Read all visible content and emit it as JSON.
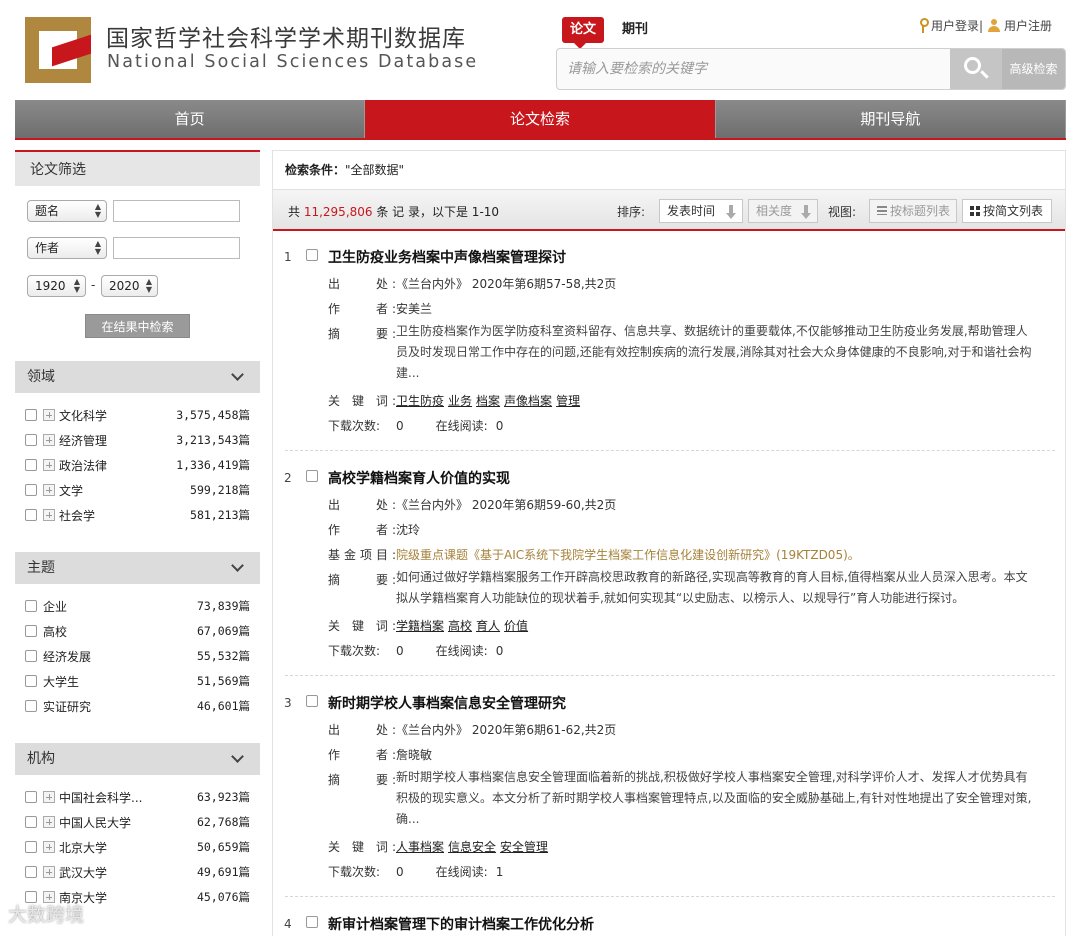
{
  "header": {
    "title_cn": "国家哲学社会科学学术期刊数据库",
    "title_en": "National Social Sciences Database",
    "search_types": [
      "论文",
      "期刊"
    ],
    "search_placeholder": "请输入要检索的关键字",
    "advanced_search": "高级检索",
    "login": "用户登录|",
    "register": "用户注册"
  },
  "nav": {
    "items": [
      "首页",
      "论文检索",
      "期刊导航"
    ],
    "active_index": 1
  },
  "sidebar": {
    "filter_title": "论文筛选",
    "field1": "题名",
    "field2": "作者",
    "year_from": "1920",
    "year_to": "2020",
    "year_dash": "-",
    "search_in_results": "在结果中检索",
    "facets": [
      {
        "title": "领域",
        "items": [
          {
            "label": "文化科学",
            "count": "3,575,458篇"
          },
          {
            "label": "经济管理",
            "count": "3,213,543篇"
          },
          {
            "label": "政治法律",
            "count": "1,336,419篇"
          },
          {
            "label": "文学",
            "count": "599,218篇"
          },
          {
            "label": "社会学",
            "count": "581,213篇"
          }
        ]
      },
      {
        "title": "主题",
        "items": [
          {
            "label": "企业",
            "count": "73,839篇"
          },
          {
            "label": "高校",
            "count": "67,069篇"
          },
          {
            "label": "经济发展",
            "count": "55,532篇"
          },
          {
            "label": "大学生",
            "count": "51,569篇"
          },
          {
            "label": "实证研究",
            "count": "46,601篇"
          }
        ]
      },
      {
        "title": "机构",
        "items": [
          {
            "label": "中国社会科学...",
            "count": "63,923篇"
          },
          {
            "label": "中国人民大学",
            "count": "62,768篇"
          },
          {
            "label": "北京大学",
            "count": "50,659篇"
          },
          {
            "label": "武汉大学",
            "count": "49,691篇"
          },
          {
            "label": "南京大学",
            "count": "45,076篇"
          }
        ]
      }
    ]
  },
  "main": {
    "condition_label": "检索条件：",
    "condition_value": "\"全部数据\"",
    "total_prefix": "共 ",
    "total_count": "11,295,806",
    "total_suffix": " 条 记 录，以下是 1-10",
    "sort_label": "排序:",
    "sort_time": "发表时间",
    "sort_relevance": "相关度",
    "view_label": "视图:",
    "view_title_list": "按标题列表",
    "view_abstract_list": "按简文列表"
  },
  "labels": {
    "source": "出　　处:",
    "author": "作　　者:",
    "fund": "基金项目:",
    "abstract": "摘　　要:",
    "keywords": "关 键 词:",
    "downloads": "下载次数:",
    "online_reads": "在线阅读:"
  },
  "results": [
    {
      "num": "1",
      "title": "卫生防疫业务档案中声像档案管理探讨",
      "source": "《兰台内外》 2020年第6期57-58,共2页",
      "author": "安美兰",
      "abstract": "卫生防疫档案作为医学防疫科室资料留存、信息共享、数据统计的重要载体,不仅能够推动卫生防疫业务发展,帮助管理人员及时发现日常工作中存在的问题,还能有效控制疾病的流行发展,消除其对社会大众身体健康的不良影响,对于和谐社会构建...",
      "keywords": [
        "卫生防疫",
        "业务",
        "档案",
        "声像档案",
        "管理"
      ],
      "downloads": "0",
      "reads": "0"
    },
    {
      "num": "2",
      "title": "高校学籍档案育人价值的实现",
      "source": "《兰台内外》 2020年第6期59-60,共2页",
      "author": "沈玲",
      "fund": "院级重点课题《基于AIC系统下我院学生档案工作信息化建设创新研究》(19KTZD05)。",
      "abstract": "如何通过做好学籍档案服务工作开辟高校思政教育的新路径,实现高等教育的育人目标,值得档案从业人员深入思考。本文拟从学籍档案育人功能缺位的现状着手,就如何实现其“以史励志、以榜示人、以规导行”育人功能进行探讨。",
      "keywords": [
        "学籍档案",
        "高校",
        "育人",
        "价值"
      ],
      "downloads": "0",
      "reads": "0"
    },
    {
      "num": "3",
      "title": "新时期学校人事档案信息安全管理研究",
      "source": "《兰台内外》 2020年第6期61-62,共2页",
      "author": "詹晓敏",
      "abstract": "新时期学校人事档案信息安全管理面临着新的挑战,积极做好学校人事档案安全管理,对科学评价人才、发挥人才优势具有积极的现实意义。本文分析了新时期学校人事档案管理特点,以及面临的安全威胁基础上,有针对性地提出了安全管理对策,确...",
      "keywords": [
        "人事档案",
        "信息安全",
        "安全管理"
      ],
      "downloads": "0",
      "reads": "1"
    },
    {
      "num": "4",
      "title": "新审计档案管理下的审计档案工作优化分析"
    }
  ],
  "watermark": "大数跨境",
  "colors": {
    "accent_red": "#c8161d",
    "logo_gold": "#b0873f",
    "fund_gold": "#a6823a"
  }
}
